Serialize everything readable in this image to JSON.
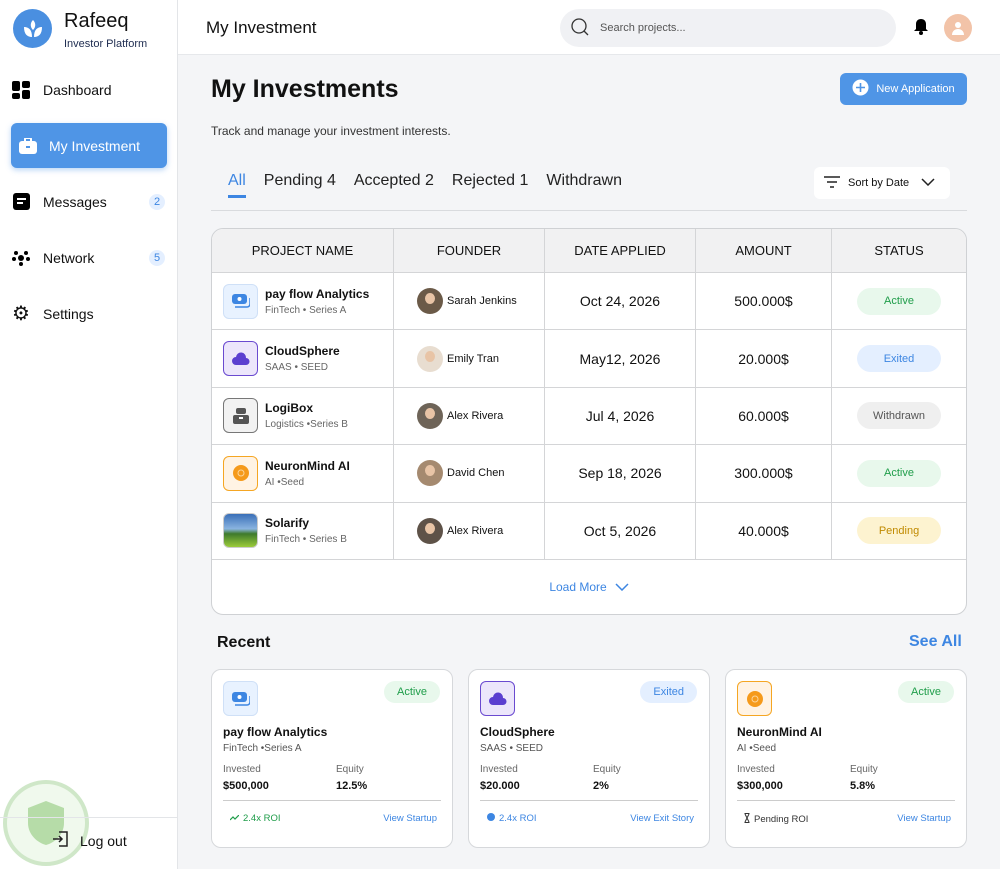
{
  "sidebar": {
    "brand": "Rafeeq",
    "subtitle": "Investor Platform",
    "items": [
      {
        "label": "Dashboard"
      },
      {
        "label": "My Investment"
      },
      {
        "label": "Messages",
        "badge": "2"
      },
      {
        "label": "Network",
        "badge": "5"
      },
      {
        "label": "Settings"
      }
    ],
    "logout": "Log out"
  },
  "header": {
    "title": "My Investment",
    "search_placeholder": "Search projects..."
  },
  "page": {
    "title": "My Investments",
    "subtitle": "Track and manage your investment interests.",
    "new_button": "New Application",
    "sort": "Sort by Date"
  },
  "tabs": [
    {
      "label": "All"
    },
    {
      "label": "Pending 4"
    },
    {
      "label": "Accepted 2"
    },
    {
      "label": "Rejected 1"
    },
    {
      "label": "Withdrawn"
    }
  ],
  "table": {
    "columns": [
      "PROJECT NAME",
      "FOUNDER",
      "DATE APPLIED",
      "AMOUNT",
      "STATUS"
    ],
    "rows": [
      {
        "name": "pay flow Analytics",
        "category": "FinTech  • Series A",
        "founder": "Sarah Jenkins",
        "date": "Oct 24, 2026",
        "amount": "500.000$",
        "status": "Active"
      },
      {
        "name": "CloudSphere",
        "category": "SAAS • SEED",
        "founder": "Emily Tran",
        "date": "May12, 2026",
        "amount": "20.000$",
        "status": "Exited"
      },
      {
        "name": "LogiBox",
        "category": "Logistics •Series B",
        "founder": "Alex Rivera",
        "date": "Jul 4, 2026",
        "amount": "60.000$",
        "status": "Withdrawn"
      },
      {
        "name": "NeuronMind AI",
        "category": "AI •Seed",
        "founder": "David Chen",
        "date": "Sep 18, 2026",
        "amount": "300.000$",
        "status": "Active"
      },
      {
        "name": "Solarify",
        "category": "FinTech  • Series B",
        "founder": "Alex Rivera",
        "date": "Oct 5, 2026",
        "amount": "40.000$",
        "status": "Pending"
      }
    ],
    "load_more": "Load More"
  },
  "recent": {
    "title": "Recent",
    "see_all": "See All",
    "invested_label": "Invested",
    "equity_label": "Equity",
    "cards": [
      {
        "name": "pay flow Analytics",
        "category": "FinTech •Series A",
        "status": "Active",
        "invested": "$500,000",
        "equity": "12.5%",
        "roi": "2.4x ROI",
        "link": "View Startup"
      },
      {
        "name": "CloudSphere",
        "category": "SAAS • SEED",
        "status": "Exited",
        "invested": "$20.000",
        "equity": "2%",
        "roi": "2.4x ROI",
        "link": "View Exit Story"
      },
      {
        "name": "NeuronMind AI",
        "category": "AI •Seed",
        "status": "Active",
        "invested": "$300,000",
        "equity": "5.8%",
        "roi": "Pending ROI",
        "link": "View Startup"
      }
    ]
  },
  "colors": {
    "accent": "#4f95e6",
    "active_bg": "#e8f8ec",
    "active_fg": "#1f9d4a",
    "exited_bg": "#e4efff",
    "exited_fg": "#3d86e2",
    "withdrawn_bg": "#efefef",
    "withdrawn_fg": "#555555",
    "pending_bg": "#fdf3d0",
    "pending_fg": "#c08a00"
  }
}
